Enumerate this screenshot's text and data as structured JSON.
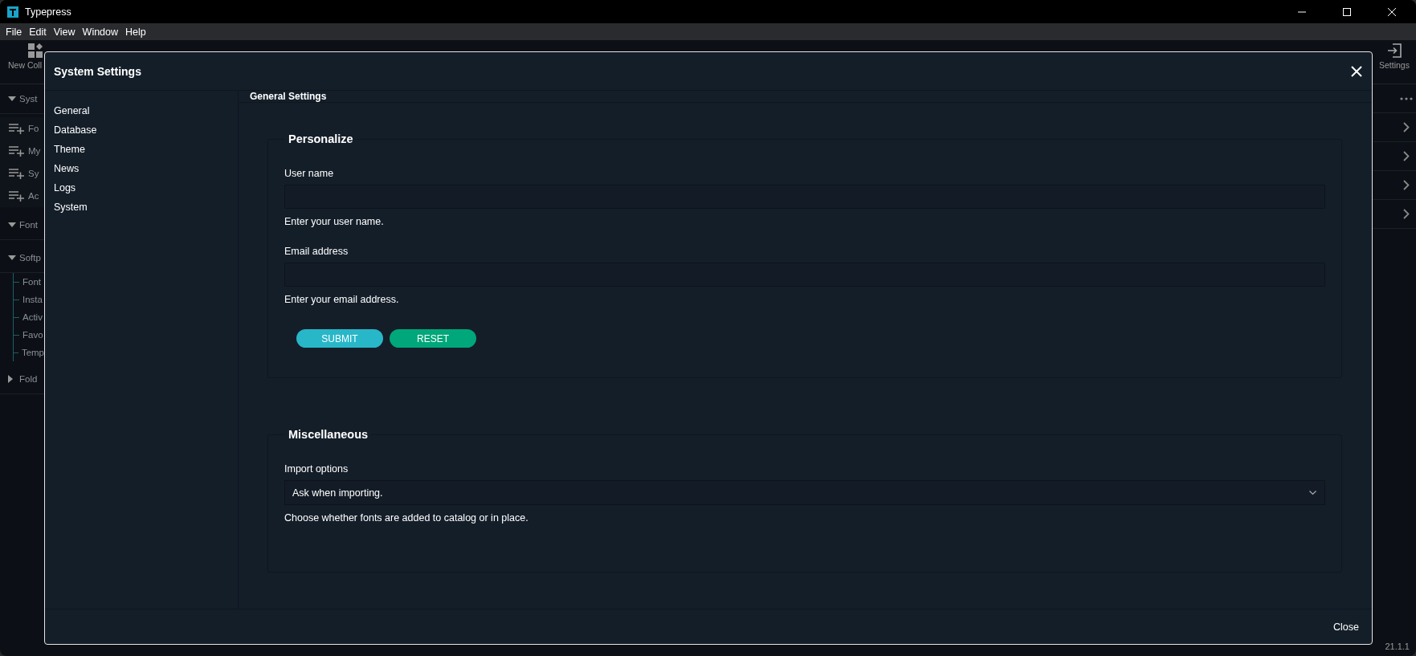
{
  "window": {
    "title": "Typepress"
  },
  "menu": [
    "File",
    "Edit",
    "View",
    "Window",
    "Help"
  ],
  "toolbar": [
    {
      "label": "New Coll",
      "kind": "grid"
    },
    {
      "label": "Settings",
      "kind": "exit"
    }
  ],
  "sidebar": [
    {
      "label": "Syst",
      "kind": "section",
      "expanded": true,
      "children": [
        {
          "label": "Fo",
          "kind": "list"
        },
        {
          "label": "My",
          "kind": "list"
        },
        {
          "label": "Sy",
          "kind": "list"
        },
        {
          "label": "Ac",
          "kind": "list"
        }
      ]
    },
    {
      "label": "Font",
      "kind": "section",
      "expanded": true,
      "children": [
        {
          "label": "Softp",
          "kind": "section",
          "expanded": true,
          "children": [
            {
              "label": "Font",
              "kind": "leaf"
            },
            {
              "label": "Insta",
              "kind": "leaf"
            },
            {
              "label": "Activ",
              "kind": "leaf"
            },
            {
              "label": "Favo",
              "kind": "leaf"
            },
            {
              "label": "Temp",
              "kind": "leaf"
            }
          ]
        }
      ]
    },
    {
      "label": "Fold",
      "kind": "section",
      "expanded": false
    }
  ],
  "version": "21.1.1",
  "dialog": {
    "title": "System Settings",
    "nav": [
      "General",
      "Database",
      "Theme",
      "News",
      "Logs",
      "System"
    ],
    "heading": "General Settings",
    "groups": [
      {
        "legend": "Personalize",
        "fields": [
          {
            "kind": "text",
            "label": "User name",
            "hint": "Enter your user name."
          },
          {
            "kind": "text",
            "label": "Email address",
            "hint": "Enter your email address."
          }
        ],
        "buttons": [
          {
            "label": "SUBMIT",
            "kind": "primary"
          },
          {
            "label": "RESET",
            "kind": "secondary"
          }
        ]
      },
      {
        "legend": "Miscellaneous",
        "fields": [
          {
            "kind": "select",
            "label": "Import options",
            "value": "Ask when importing.",
            "hint": "Choose whether fonts are added to catalog or in place."
          }
        ]
      }
    ],
    "footer_button": "Close"
  }
}
